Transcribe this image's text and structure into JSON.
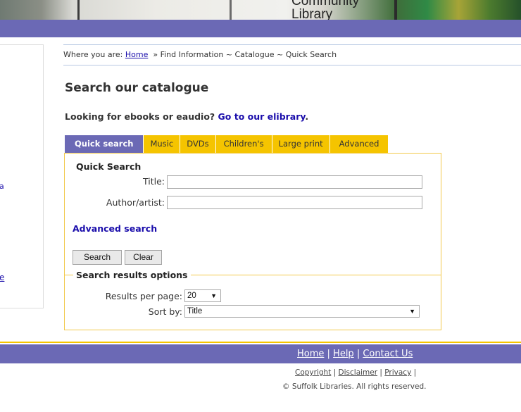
{
  "banner": {
    "sign_line1": "Community",
    "sign_line2": "Library"
  },
  "left_panel": {
    "frag1": "a",
    "frag2": "e"
  },
  "breadcrumb": {
    "prefix": "Where you are: ",
    "home": "Home",
    "rest": "  » Find Information ~ Catalogue ~ Quick Search"
  },
  "page_title": "Search our catalogue",
  "ebook": {
    "text": "Looking for ebooks or eaudio? ",
    "link": "Go to our elibrary",
    "suffix": "."
  },
  "tabs": [
    {
      "label": "Quick search",
      "active": true
    },
    {
      "label": "Music",
      "active": false
    },
    {
      "label": "DVDs",
      "active": false
    },
    {
      "label": "Children's",
      "active": false
    },
    {
      "label": "Large print",
      "active": false
    },
    {
      "label": "Advanced",
      "active": false
    }
  ],
  "quick_search": {
    "heading": "Quick Search",
    "title_label": "Title:",
    "title_value": "",
    "author_label": "Author/artist:",
    "author_value": "",
    "advanced_link": "Advanced search",
    "search_button": "Search",
    "clear_button": "Clear"
  },
  "results_options": {
    "legend": "Search results options",
    "per_page_label": "Results per page:",
    "per_page_value": "20",
    "sort_label": "Sort by:",
    "sort_value": "Title"
  },
  "footer": {
    "home": "Home",
    "sep": " | ",
    "help": "Help",
    "contact": "Contact Us",
    "copyright": "Copyright",
    "disclaimer": "Disclaimer",
    "privacy": "Privacy",
    "rights": "© Suffolk Libraries. All rights reserved."
  },
  "colors": {
    "purple": "#6b69b5",
    "yellow": "#f5c400",
    "link": "#1a0dab"
  }
}
